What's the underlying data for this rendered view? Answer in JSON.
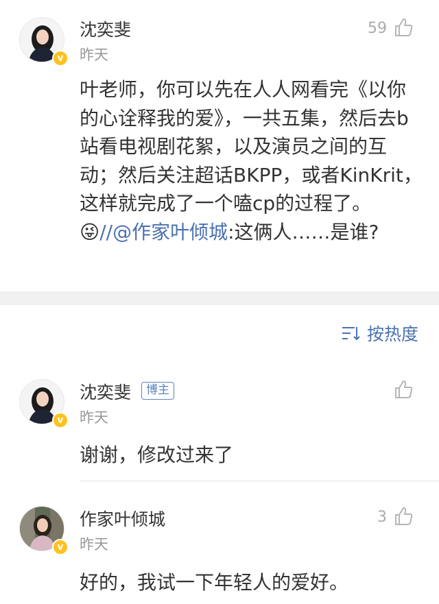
{
  "main_comment": {
    "username": "沈奕斐",
    "time": "昨天",
    "likes": "59",
    "text_before": "叶老师，你可以先在人人网看完《以你的心诠释我的爱》，一共五集，然后去b站看电视剧花絮，以及演员之间的互动；然后关注超话BKPP，或者KinKrit，这样就完成了一个嗑cp的过程了。",
    "emoji": "😜",
    "slashes": "//",
    "mention": "@作家叶倾城",
    "text_after": ":这俩人……是谁?"
  },
  "sort": {
    "label": "按热度",
    "icon": "sort-icon"
  },
  "replies": [
    {
      "username": "沈奕斐",
      "badge": "博主",
      "time": "昨天",
      "likes": "",
      "text": "谢谢，修改过来了"
    },
    {
      "username": "作家叶倾城",
      "time": "昨天",
      "likes": "3",
      "text": "好的，我试一下年轻人的爱好。"
    }
  ],
  "colors": {
    "link": "#4a71b0",
    "verified": "#ffc11e",
    "band": "#f0f0f0"
  }
}
